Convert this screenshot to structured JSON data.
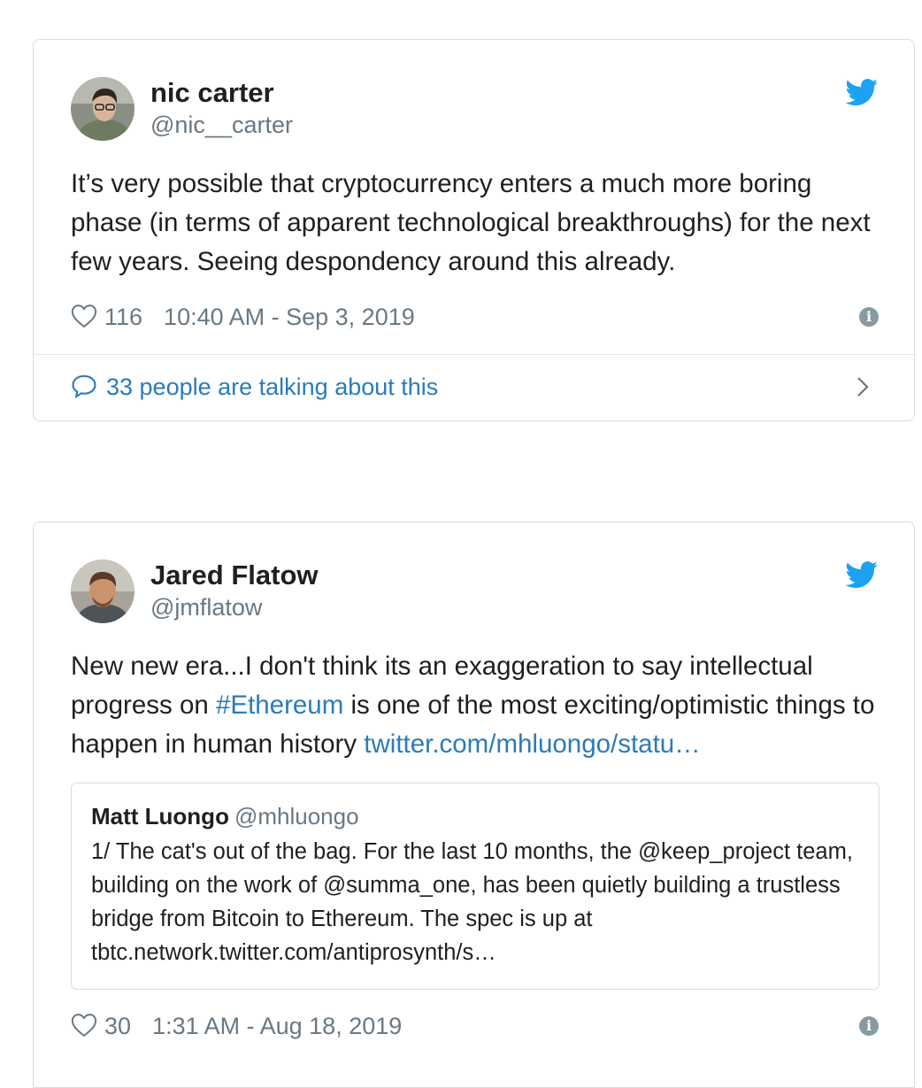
{
  "tweets": [
    {
      "name": "nic carter",
      "handle": "@nic__carter",
      "text": "It’s very possible that cryptocurrency enters a much more boring phase (in terms of apparent technological breakthroughs) for the next few years. Seeing despondency around this already.",
      "likes": "116",
      "timestamp": "10:40 AM - Sep 3, 2019",
      "talking": "33 people are talking about this"
    },
    {
      "name": "Jared Flatow",
      "handle": "@jmflatow",
      "text_1": "New new era...I don't think its an exaggeration to say intellectual progress on ",
      "hashtag": "#Ethereum",
      "text_2": " is one of the most exciting/optimistic things to happen in human history ",
      "link": "twitter.com/mhluongo/statu…",
      "quote": {
        "name": "Matt Luongo",
        "handle": "@mhluongo",
        "text": "1/ The cat's out of the bag. For the last 10 months, the @keep_project team, building on the work of @summa_one, has been quietly building a trustless bridge from Bitcoin to Ethereum. The spec is up at tbtc.network.twitter.com/antiprosynth/s…"
      },
      "likes": "30",
      "timestamp": "1:31 AM - Aug 18, 2019"
    }
  ],
  "icons": {
    "brand": "twitter-bird-icon",
    "like": "heart-icon",
    "info": "info-icon",
    "reply": "speech-bubble-icon",
    "chevron": "chevron-right-icon"
  },
  "colors": {
    "link": "#2b7bb9",
    "bird": "#1da1f2",
    "muted": "#697882",
    "border": "#d6dfe5"
  }
}
